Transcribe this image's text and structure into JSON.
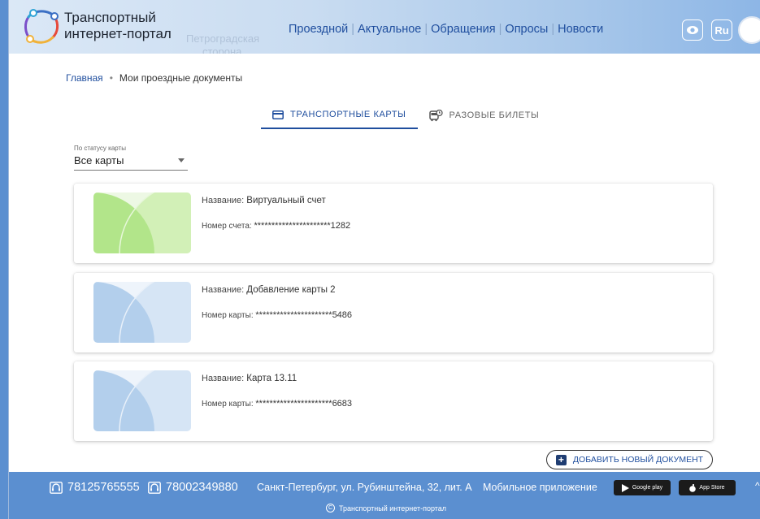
{
  "header": {
    "brand_line1": "Транспортный",
    "brand_line2": "интернет-портал",
    "map_labels": [
      "Петроградская",
      "сторона"
    ],
    "nav": [
      {
        "label": "Проездной"
      },
      {
        "label": "Актуальное"
      },
      {
        "label": "Обращения"
      },
      {
        "label": "Опросы"
      },
      {
        "label": "Новости"
      }
    ],
    "eye_icon": "eye-icon",
    "lang_label": "Ru"
  },
  "breadcrumb": {
    "home": "Главная",
    "separator": "•",
    "current": "Мои проездные документы"
  },
  "tabs": [
    {
      "label": "ТРАНСПОРТНЫЕ КАРТЫ",
      "icon": "card-icon",
      "active": true
    },
    {
      "label": "РАЗОВЫЕ БИЛЕТЫ",
      "icon": "bus-icon",
      "active": false
    }
  ],
  "filter": {
    "label": "По статусу карты",
    "value": "Все карты"
  },
  "cards": [
    {
      "name_label": "Название:",
      "name": "Виртуальный счет",
      "num_label": "Номер счета:",
      "number": "**********************1282",
      "color": "#a8e07a"
    },
    {
      "name_label": "Название:",
      "name": "Добавление карты 2",
      "num_label": "Номер карты:",
      "number": "**********************5486",
      "color": "#a9c6e8"
    },
    {
      "name_label": "Название:",
      "name": "Карта 13.11",
      "num_label": "Номер карты:",
      "number": "**********************6683",
      "color": "#a9c6e8"
    }
  ],
  "add_button": {
    "label": "ДОБАВИТЬ НОВЫЙ ДОКУМЕНТ"
  },
  "footer": {
    "phone1": "78125765555",
    "phone2": "78002349880",
    "address": "Санкт-Петербург, ул. Рубинштейна, 32, лит. А",
    "mobile_label": "Мобильное приложение",
    "google_play": "Google play",
    "app_store": "App Store",
    "copyright": "Транспортный интернет-портал"
  },
  "colors": {
    "accent": "#1f4e9e",
    "footer": "#5b8fd0"
  }
}
